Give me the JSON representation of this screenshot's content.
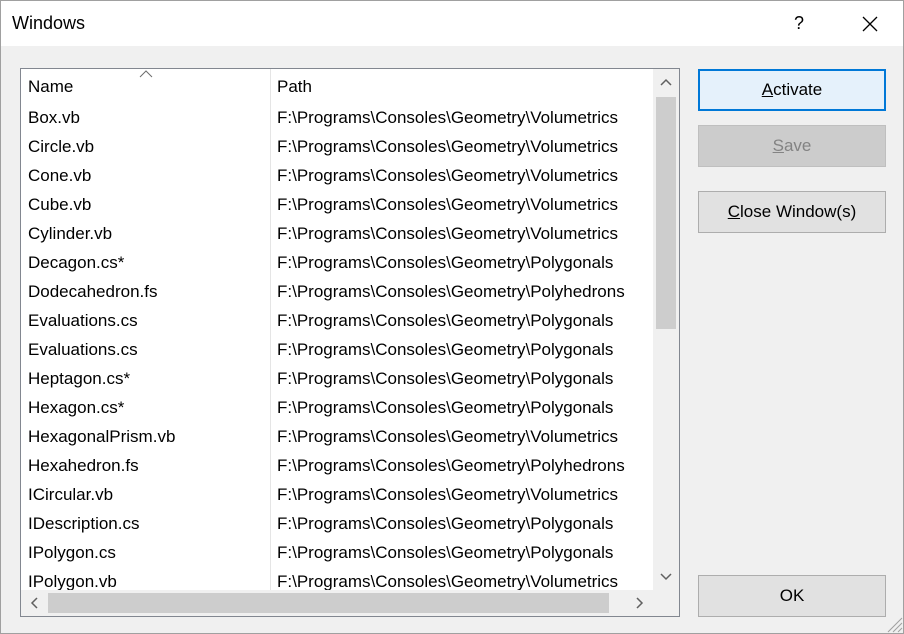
{
  "window": {
    "title": "Windows",
    "help_label": "?"
  },
  "list": {
    "columns": {
      "name": "Name",
      "path": "Path"
    },
    "rows": [
      {
        "name": "Box.vb",
        "path": "F:\\Programs\\Consoles\\Geometry\\Volumetrics"
      },
      {
        "name": "Circle.vb",
        "path": "F:\\Programs\\Consoles\\Geometry\\Volumetrics"
      },
      {
        "name": "Cone.vb",
        "path": "F:\\Programs\\Consoles\\Geometry\\Volumetrics"
      },
      {
        "name": "Cube.vb",
        "path": "F:\\Programs\\Consoles\\Geometry\\Volumetrics"
      },
      {
        "name": "Cylinder.vb",
        "path": "F:\\Programs\\Consoles\\Geometry\\Volumetrics"
      },
      {
        "name": "Decagon.cs*",
        "path": "F:\\Programs\\Consoles\\Geometry\\Polygonals"
      },
      {
        "name": "Dodecahedron.fs",
        "path": "F:\\Programs\\Consoles\\Geometry\\Polyhedrons"
      },
      {
        "name": "Evaluations.cs",
        "path": "F:\\Programs\\Consoles\\Geometry\\Polygonals"
      },
      {
        "name": "Evaluations.cs",
        "path": "F:\\Programs\\Consoles\\Geometry\\Polygonals"
      },
      {
        "name": "Heptagon.cs*",
        "path": "F:\\Programs\\Consoles\\Geometry\\Polygonals"
      },
      {
        "name": "Hexagon.cs*",
        "path": "F:\\Programs\\Consoles\\Geometry\\Polygonals"
      },
      {
        "name": "HexagonalPrism.vb",
        "path": "F:\\Programs\\Consoles\\Geometry\\Volumetrics"
      },
      {
        "name": "Hexahedron.fs",
        "path": "F:\\Programs\\Consoles\\Geometry\\Polyhedrons"
      },
      {
        "name": "ICircular.vb",
        "path": "F:\\Programs\\Consoles\\Geometry\\Volumetrics"
      },
      {
        "name": "IDescription.cs",
        "path": "F:\\Programs\\Consoles\\Geometry\\Polygonals"
      },
      {
        "name": "IPolygon.cs",
        "path": "F:\\Programs\\Consoles\\Geometry\\Polygonals"
      },
      {
        "name": "IPolygon.vb",
        "path": "F:\\Programs\\Consoles\\Geometry\\Volumetrics"
      }
    ]
  },
  "buttons": {
    "activate": {
      "accel": "A",
      "rest": "ctivate"
    },
    "save": {
      "accel": "S",
      "rest": "ave"
    },
    "close_windows": {
      "accel": "C",
      "rest": "lose Window(s)"
    },
    "ok": "OK"
  },
  "colors": {
    "accent": "#0078d7",
    "button_face": "#e1e1e1",
    "disabled_face": "#cccccc",
    "scroll_thumb": "#cdcdcd"
  }
}
